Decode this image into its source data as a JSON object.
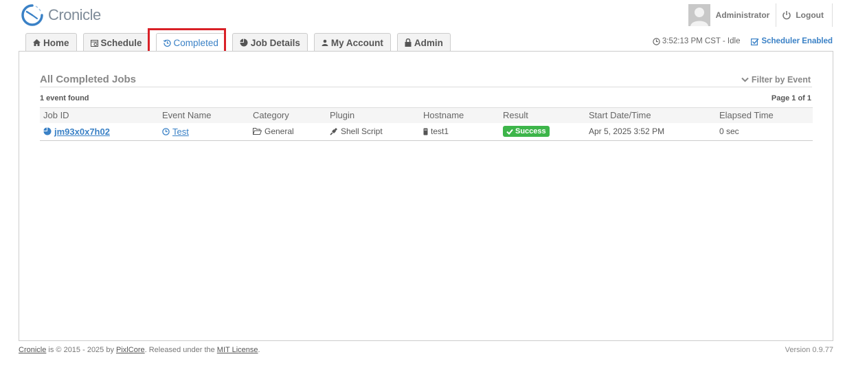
{
  "app": {
    "title": "Cronicle"
  },
  "user": {
    "name": "Administrator",
    "logout_label": "Logout"
  },
  "tabs": [
    {
      "label": "Home",
      "icon": "home-icon"
    },
    {
      "label": "Schedule",
      "icon": "calendar-icon"
    },
    {
      "label": "Completed",
      "icon": "history-icon",
      "active": true
    },
    {
      "label": "Job Details",
      "icon": "pie-chart-icon"
    },
    {
      "label": "My Account",
      "icon": "user-icon"
    },
    {
      "label": "Admin",
      "icon": "lock-icon"
    }
  ],
  "status": {
    "clock": "3:52:13 PM CST - Idle",
    "scheduler": "Scheduler Enabled"
  },
  "section": {
    "title": "All Completed Jobs",
    "filter_label": "Filter by Event",
    "found": "1 event found",
    "page_info": "Page 1 of 1"
  },
  "table": {
    "headers": [
      "Job ID",
      "Event Name",
      "Category",
      "Plugin",
      "Hostname",
      "Result",
      "Start Date/Time",
      "Elapsed Time"
    ],
    "rows": [
      {
        "job_id": "jm93x0x7h02",
        "event": "Test",
        "category": "General",
        "plugin": "Shell Script",
        "hostname": "test1",
        "result": "Success",
        "start": "Apr 5, 2025 3:52 PM",
        "elapsed": "0 sec"
      }
    ]
  },
  "footer": {
    "app_link": "Cronicle",
    "text1": " is © 2015 - 2025 by ",
    "company_link": "PixlCore",
    "text2": ". Released under the ",
    "license_link": "MIT License",
    "text3": ".",
    "version": "Version 0.9.77"
  },
  "colors": {
    "accent": "#3a81c6",
    "success": "#3db54a",
    "highlight": "#d92027"
  }
}
